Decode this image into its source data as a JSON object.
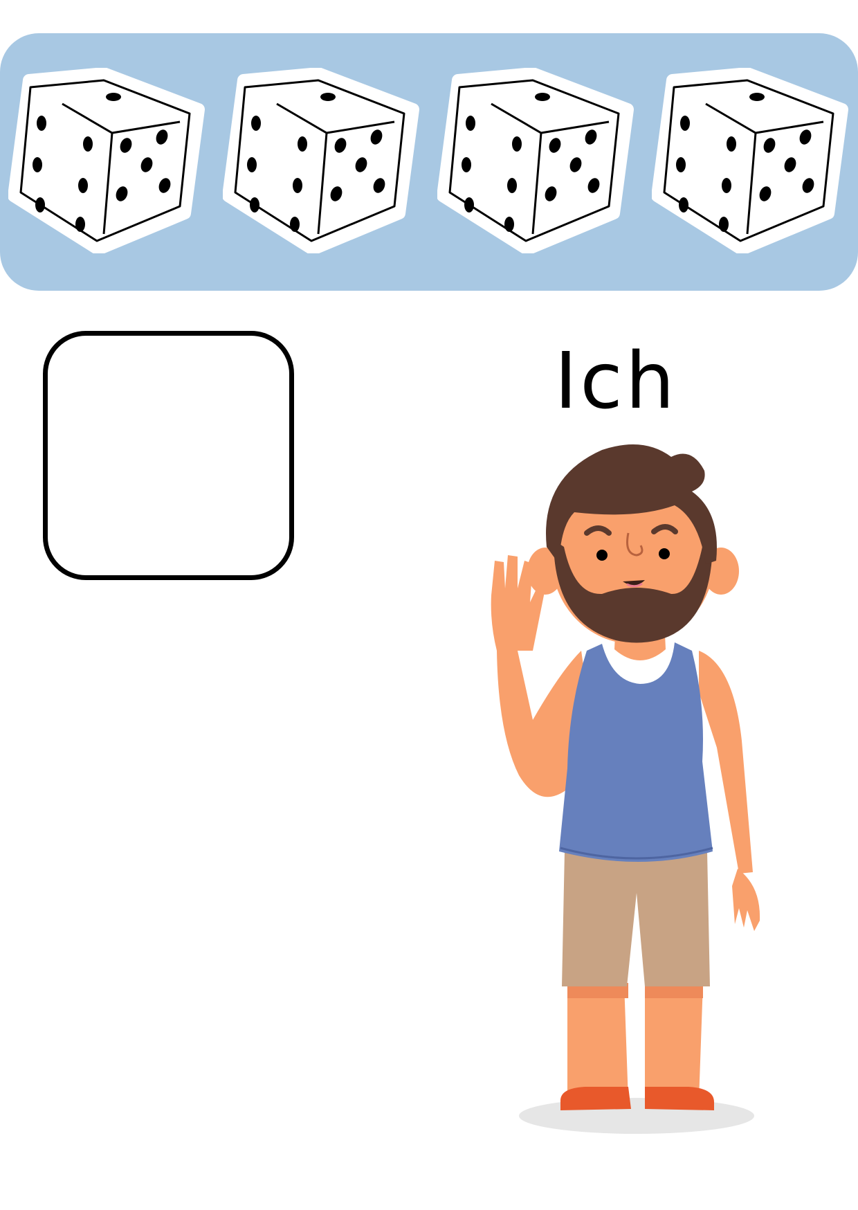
{
  "worksheet": {
    "pronoun_label": "Ich",
    "dice": [
      {
        "icon": "die-icon",
        "top_face_pips": 1,
        "left_face_pips": 6,
        "right_face_pips": 5
      },
      {
        "icon": "die-icon",
        "top_face_pips": 1,
        "left_face_pips": 6,
        "right_face_pips": 5
      },
      {
        "icon": "die-icon",
        "top_face_pips": 1,
        "left_face_pips": 6,
        "right_face_pips": 5
      },
      {
        "icon": "die-icon",
        "top_face_pips": 1,
        "left_face_pips": 6,
        "right_face_pips": 5
      }
    ],
    "illustration": "waving-man-illustration",
    "colors": {
      "banner": "#a8c8e3",
      "box_border": "#000000",
      "tank_top": "#6680bd",
      "shorts": "#c8a384",
      "skin": "#f9a06c",
      "hair": "#5a392d",
      "shoes": "#e8592b"
    }
  }
}
